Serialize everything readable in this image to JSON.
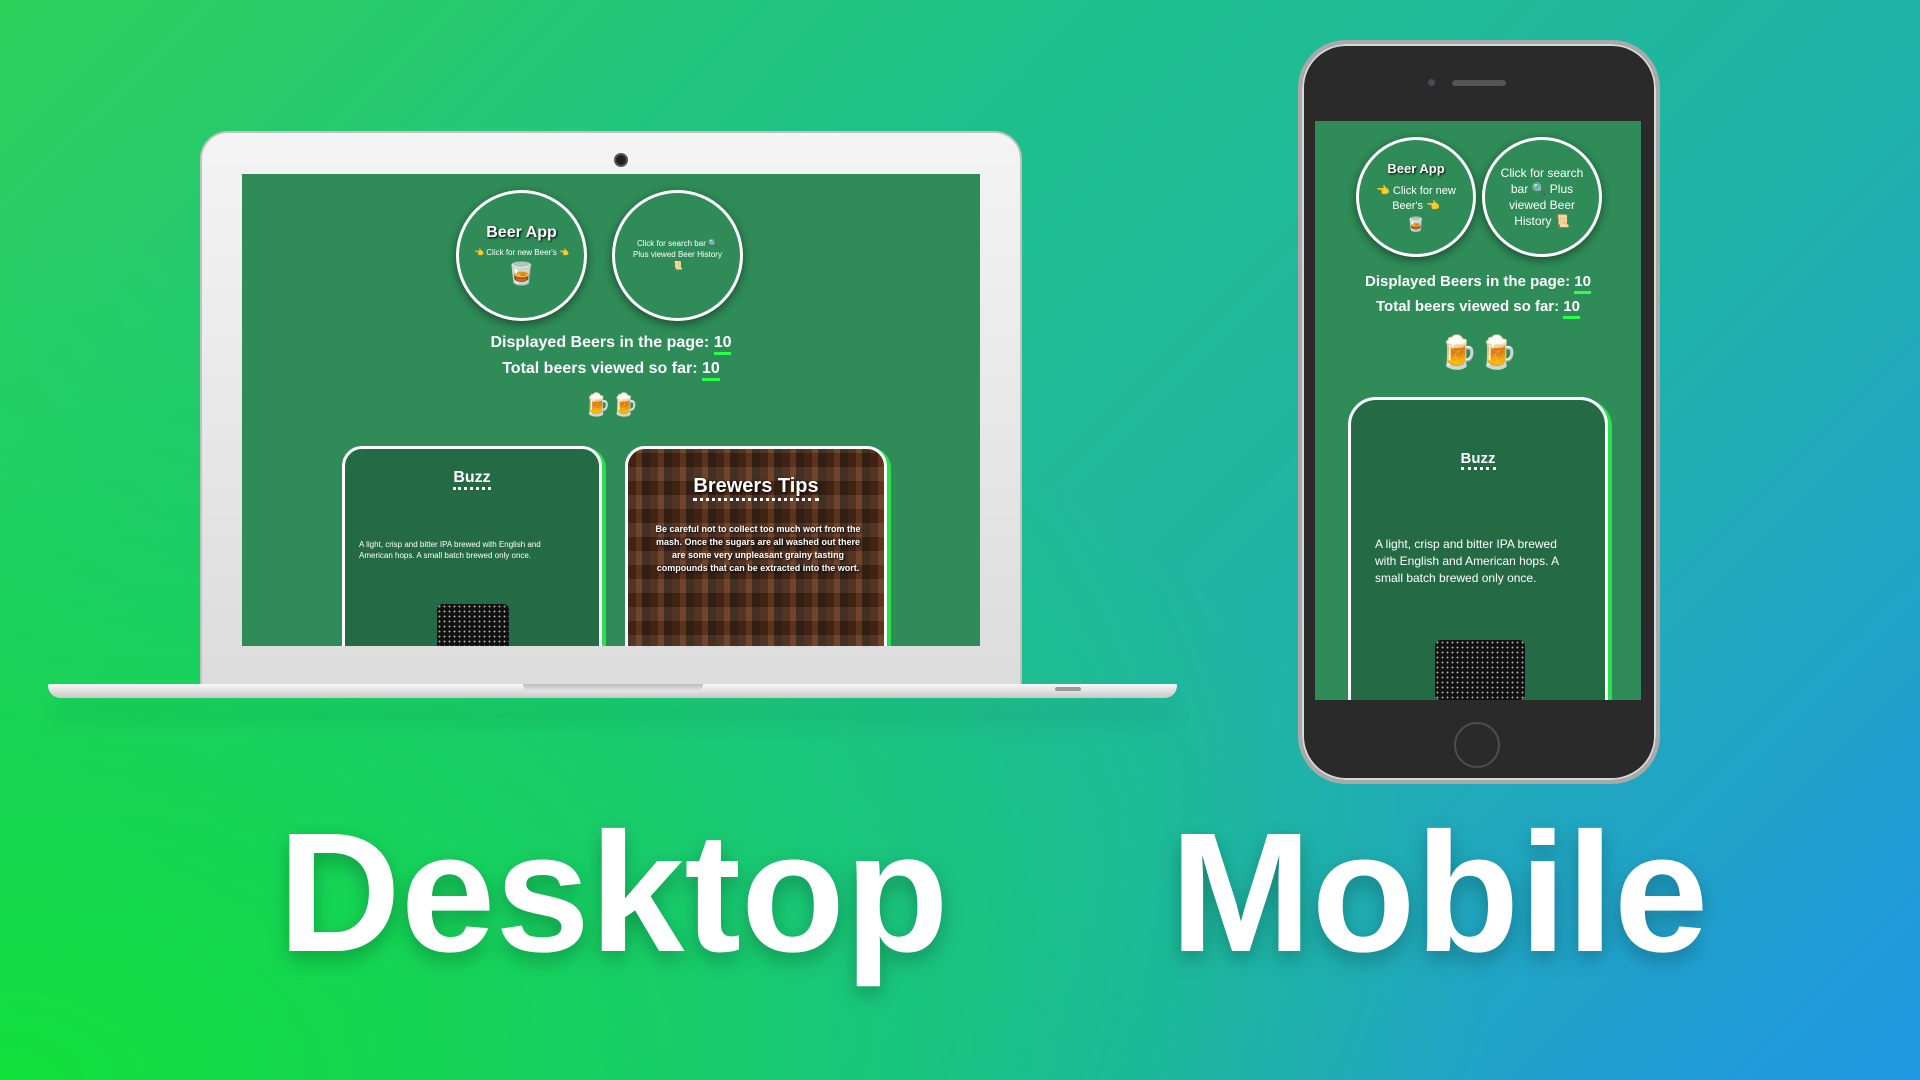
{
  "app": {
    "title": "Beer App",
    "new_beers": "👈 Click for new Beer's 👈",
    "new_beers_mobile_line1": "👈 Click for new",
    "new_beers_mobile_line2": "Beer's 👈",
    "beer_glass": "🥃",
    "search_desktop": "Click for search bar 🔍 Plus viewed Beer History 📜",
    "search_mobile": "Click for search bar 🔍 Plus viewed Beer History 📜",
    "displayed_label": "Displayed Beers in the page:",
    "displayed_value": "10",
    "total_label": "Total beers viewed so far:",
    "total_value": "10",
    "mugs": "🍺🍺"
  },
  "card": {
    "name": "Buzz",
    "description": "A light, crisp and bitter IPA brewed with English and American hops. A small batch brewed only once."
  },
  "tips": {
    "title": "Brewers Tips",
    "text": "Be careful not to collect too much wort from the mash. Once the sugars are all washed out there are some very unpleasant grainy tasting compounds that can be extracted into the wort."
  },
  "labels": {
    "desktop": "Desktop",
    "mobile": "Mobile"
  },
  "colors": {
    "app_bg": "#2f8c58",
    "card_bg": "#246b45",
    "accent": "#2aff4e"
  }
}
